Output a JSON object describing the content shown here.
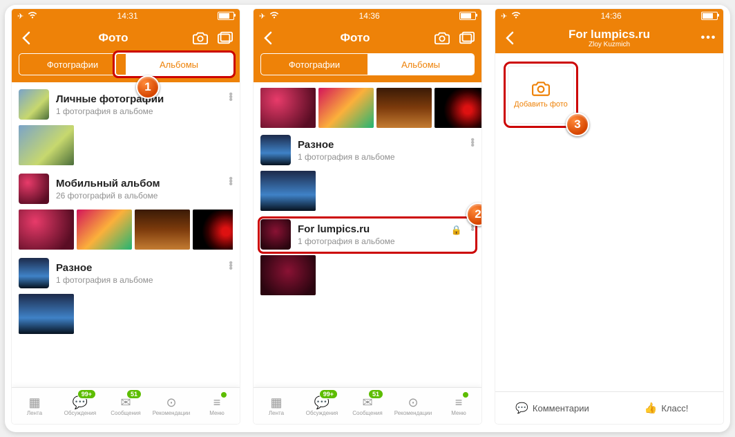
{
  "screen1": {
    "time": "14:31",
    "title": "Фото",
    "tabs": {
      "photos": "Фотографии",
      "albums": "Альбомы"
    },
    "albums": [
      {
        "name": "Личные фотографии",
        "sub": "1 фотография в альбоме"
      },
      {
        "name": "Мобильный альбом",
        "sub": "26 фотографий в альбоме"
      },
      {
        "name": "Разное",
        "sub": "1 фотография в альбоме"
      }
    ]
  },
  "screen2": {
    "time": "14:36",
    "title": "Фото",
    "tabs": {
      "photos": "Фотографии",
      "albums": "Альбомы"
    },
    "albums": [
      {
        "name": "Разное",
        "sub": "1 фотография в альбоме"
      },
      {
        "name": "For lumpics.ru",
        "sub": "1 фотография в альбоме"
      }
    ]
  },
  "screen3": {
    "time": "14:36",
    "title": "For lumpics.ru",
    "subtitle": "Zloy Kuzmich",
    "add_label": "Добавить фото",
    "comments": "Комментарии",
    "klass": "Класс!"
  },
  "tabbar": {
    "items": [
      {
        "label": "Лента"
      },
      {
        "label": "Обсуждения",
        "badge": "99+"
      },
      {
        "label": "Сообщения",
        "badge": "51"
      },
      {
        "label": "Рекомендации"
      },
      {
        "label": "Меню",
        "dot": true
      }
    ]
  },
  "markers": {
    "m1": "1",
    "m2": "2",
    "m3": "3"
  }
}
